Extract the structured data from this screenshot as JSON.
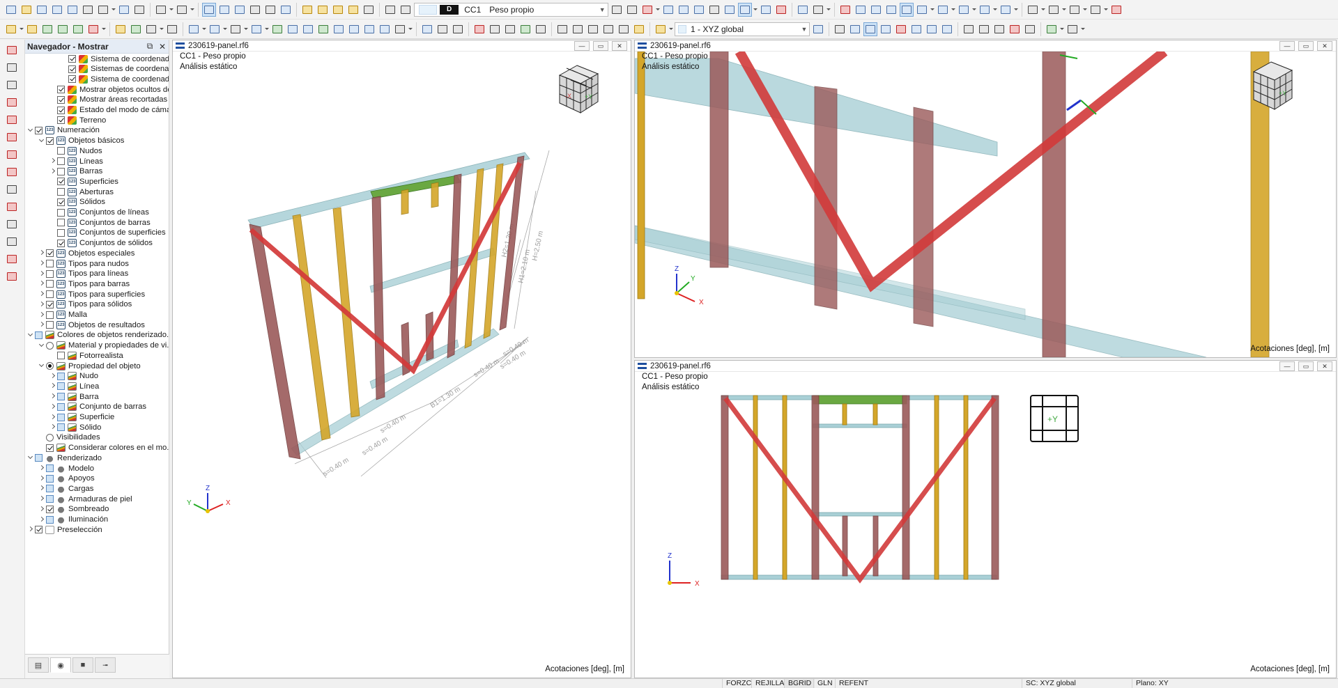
{
  "toolbar": {
    "load_case": {
      "badge": "D",
      "code": "CC1",
      "name": "Peso propio"
    },
    "coord_system": "1 - XYZ global"
  },
  "navigator": {
    "title": "Navegador - Mostrar",
    "pin_icon": "pin-icon",
    "close_icon": "close-icon",
    "items": [
      {
        "label": "Sistema de coordenadas...",
        "level": 3,
        "expander": "none",
        "control": "check",
        "checked": true,
        "icon": "colors"
      },
      {
        "label": "Sistemas de coordenada...",
        "level": 3,
        "expander": "none",
        "control": "check",
        "checked": true,
        "icon": "colors"
      },
      {
        "label": "Sistema de coordenadas...",
        "level": 3,
        "expander": "none",
        "control": "check",
        "checked": true,
        "icon": "colors"
      },
      {
        "label": "Mostrar objetos ocultos de ...",
        "level": 2,
        "expander": "none",
        "control": "check",
        "checked": true,
        "icon": "colors"
      },
      {
        "label": "Mostrar áreas recortadas",
        "level": 2,
        "expander": "none",
        "control": "check",
        "checked": true,
        "icon": "colors"
      },
      {
        "label": "Estado del modo de cámara ...",
        "level": 2,
        "expander": "none",
        "control": "check",
        "checked": true,
        "icon": "colors"
      },
      {
        "label": "Terreno",
        "level": 2,
        "expander": "none",
        "control": "check",
        "checked": true,
        "icon": "colors"
      },
      {
        "label": "Numeración",
        "level": 0,
        "expander": "open",
        "control": "check",
        "checked": true,
        "icon": "num"
      },
      {
        "label": "Objetos básicos",
        "level": 1,
        "expander": "open",
        "control": "check",
        "checked": true,
        "icon": "num"
      },
      {
        "label": "Nudos",
        "level": 2,
        "expander": "none",
        "control": "check",
        "checked": false,
        "icon": "num"
      },
      {
        "label": "Líneas",
        "level": 2,
        "expander": "closed",
        "control": "check",
        "checked": false,
        "icon": "num"
      },
      {
        "label": "Barras",
        "level": 2,
        "expander": "closed",
        "control": "check",
        "checked": false,
        "icon": "num"
      },
      {
        "label": "Superficies",
        "level": 2,
        "expander": "none",
        "control": "check",
        "checked": true,
        "icon": "num"
      },
      {
        "label": "Aberturas",
        "level": 2,
        "expander": "none",
        "control": "check",
        "checked": false,
        "icon": "num"
      },
      {
        "label": "Sólidos",
        "level": 2,
        "expander": "none",
        "control": "check",
        "checked": true,
        "icon": "num"
      },
      {
        "label": "Conjuntos de líneas",
        "level": 2,
        "expander": "none",
        "control": "check",
        "checked": false,
        "icon": "num"
      },
      {
        "label": "Conjuntos de barras",
        "level": 2,
        "expander": "none",
        "control": "check",
        "checked": false,
        "icon": "num"
      },
      {
        "label": "Conjuntos de superficies",
        "level": 2,
        "expander": "none",
        "control": "check",
        "checked": false,
        "icon": "num"
      },
      {
        "label": "Conjuntos de sólidos",
        "level": 2,
        "expander": "none",
        "control": "check",
        "checked": true,
        "icon": "num"
      },
      {
        "label": "Objetos especiales",
        "level": 1,
        "expander": "closed",
        "control": "check",
        "checked": true,
        "icon": "num"
      },
      {
        "label": "Tipos para nudos",
        "level": 1,
        "expander": "closed",
        "control": "check",
        "checked": false,
        "icon": "num"
      },
      {
        "label": "Tipos para líneas",
        "level": 1,
        "expander": "closed",
        "control": "check",
        "checked": false,
        "icon": "num"
      },
      {
        "label": "Tipos para barras",
        "level": 1,
        "expander": "closed",
        "control": "check",
        "checked": false,
        "icon": "num"
      },
      {
        "label": "Tipos para superficies",
        "level": 1,
        "expander": "closed",
        "control": "check",
        "checked": false,
        "icon": "num"
      },
      {
        "label": "Tipos para sólidos",
        "level": 1,
        "expander": "closed",
        "control": "check",
        "checked": true,
        "icon": "num"
      },
      {
        "label": "Malla",
        "level": 1,
        "expander": "closed",
        "control": "check",
        "checked": false,
        "icon": "num"
      },
      {
        "label": "Objetos de resultados",
        "level": 1,
        "expander": "closed",
        "control": "check",
        "checked": false,
        "icon": "num"
      },
      {
        "label": "Colores de objetos renderizado...",
        "level": 0,
        "expander": "open",
        "control": "check",
        "checked": "partial",
        "icon": "mat"
      },
      {
        "label": "Material y propiedades de vi...",
        "level": 1,
        "expander": "open",
        "control": "radio",
        "checked": false,
        "icon": "mat"
      },
      {
        "label": "Fotorrealista",
        "level": 2,
        "expander": "none",
        "control": "check",
        "checked": false,
        "icon": "mat"
      },
      {
        "label": "Propiedad del objeto",
        "level": 1,
        "expander": "open",
        "control": "radio",
        "checked": true,
        "icon": "mat"
      },
      {
        "label": "Nudo",
        "level": 2,
        "expander": "closed",
        "control": "check",
        "checked": "partial",
        "icon": "mat"
      },
      {
        "label": "Línea",
        "level": 2,
        "expander": "closed",
        "control": "check",
        "checked": "partial",
        "icon": "mat"
      },
      {
        "label": "Barra",
        "level": 2,
        "expander": "closed",
        "control": "check",
        "checked": "partial",
        "icon": "mat"
      },
      {
        "label": "Conjunto de barras",
        "level": 2,
        "expander": "closed",
        "control": "check",
        "checked": "partial",
        "icon": "mat"
      },
      {
        "label": "Superficie",
        "level": 2,
        "expander": "closed",
        "control": "check",
        "checked": "partial",
        "icon": "mat"
      },
      {
        "label": "Sólido",
        "level": 2,
        "expander": "closed",
        "control": "check",
        "checked": "partial",
        "icon": "mat"
      },
      {
        "label": "Visibilidades",
        "level": 1,
        "expander": "none",
        "control": "radio",
        "checked": false,
        "icon": "none"
      },
      {
        "label": "Considerar colores en el mo...",
        "level": 1,
        "expander": "none",
        "control": "check",
        "checked": true,
        "icon": "mat"
      },
      {
        "label": "Renderizado",
        "level": 0,
        "expander": "open",
        "control": "check",
        "checked": "partial",
        "icon": "pot"
      },
      {
        "label": "Modelo",
        "level": 1,
        "expander": "closed",
        "control": "check",
        "checked": "partial",
        "icon": "pot"
      },
      {
        "label": "Apoyos",
        "level": 1,
        "expander": "closed",
        "control": "check",
        "checked": "partial",
        "icon": "pot"
      },
      {
        "label": "Cargas",
        "level": 1,
        "expander": "closed",
        "control": "check",
        "checked": "partial",
        "icon": "pot"
      },
      {
        "label": "Armaduras de piel",
        "level": 1,
        "expander": "closed",
        "control": "check",
        "checked": "partial",
        "icon": "pot"
      },
      {
        "label": "Sombreado",
        "level": 1,
        "expander": "closed",
        "control": "check",
        "checked": true,
        "icon": "pot"
      },
      {
        "label": "Iluminación",
        "level": 1,
        "expander": "closed",
        "control": "check",
        "checked": "partial",
        "icon": "pot"
      },
      {
        "label": "Preselección",
        "level": 0,
        "expander": "closed",
        "control": "check",
        "checked": true,
        "icon": "cur"
      }
    ],
    "bottom_tabs": [
      "data-icon",
      "display-icon",
      "views-icon",
      "results-icon"
    ]
  },
  "panes": {
    "main": {
      "title": "230619-panel.rf6",
      "caption1": "CC1 - Peso propio",
      "caption2": "Análisis estático",
      "units": "Acotaciones [deg], [m]",
      "axes": {
        "x": "X",
        "y": "Y",
        "z": "Z"
      }
    },
    "top_right": {
      "title": "230619-panel.rf6",
      "caption1": "CC1 - Peso propio",
      "caption2": "Análisis estático",
      "units": "Acotaciones [deg], [m]",
      "axes": {
        "x": "X",
        "y": "Y",
        "z": "Z"
      }
    },
    "bottom_right": {
      "title": "230619-panel.rf6",
      "caption1": "CC1 - Peso propio",
      "caption2": "Análisis estático",
      "units": "Acotaciones [deg], [m]",
      "axes": {
        "x": "X",
        "z": "Z"
      },
      "cube_label": "+Y"
    }
  },
  "dimensions": {
    "h2": "H2=1.20 m",
    "h1": "H1=2.10 m",
    "h": "H=2.50 m",
    "b1": "B1=1.30 m",
    "s_bottom": [
      "s=0.40 m",
      "s=0.40 m",
      "s=0.40 m",
      "s=0.40 m"
    ],
    "s_right": [
      "s=0.40 m",
      "s=0.40 m",
      "s=0.40 m"
    ]
  },
  "colors": {
    "stud_brown": "#9b5a5a",
    "stud_yellow": "#d4a62a",
    "diagonal_red": "#d23a3a",
    "rail_cyan": "#a9d0d6",
    "lintel_green": "#6aa842"
  },
  "status_bar": {
    "snaps": [
      "FORZC",
      "REJILLA",
      "BGRID",
      "GLN",
      "REFENT"
    ],
    "coord_system": "SC: XYZ global",
    "plane": "Plano: XY"
  }
}
